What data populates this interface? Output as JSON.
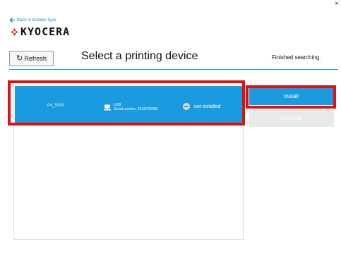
{
  "window": {
    "close_glyph": "×"
  },
  "back_link": {
    "label": "Back to installer type",
    "icon": "arrow-left-icon"
  },
  "brand": {
    "name": "KYOCERA",
    "accent_color": "#e3231a"
  },
  "toolbar": {
    "refresh_label": "Refresh",
    "refresh_icon": "refresh-icon"
  },
  "header": {
    "title": "Select a printing device",
    "status": "Finished searching."
  },
  "devices": [
    {
      "name": "P4_5000",
      "connection": "USB",
      "serial": "Serial number: 23X0700056",
      "state": "not installed",
      "selected": true
    }
  ],
  "actions": {
    "install_label": "Install",
    "uninstall_label": "Uninstall"
  },
  "colors": {
    "accent": "#1a9be0",
    "highlight": "#e01010",
    "disabled": "#e9e9e9"
  }
}
